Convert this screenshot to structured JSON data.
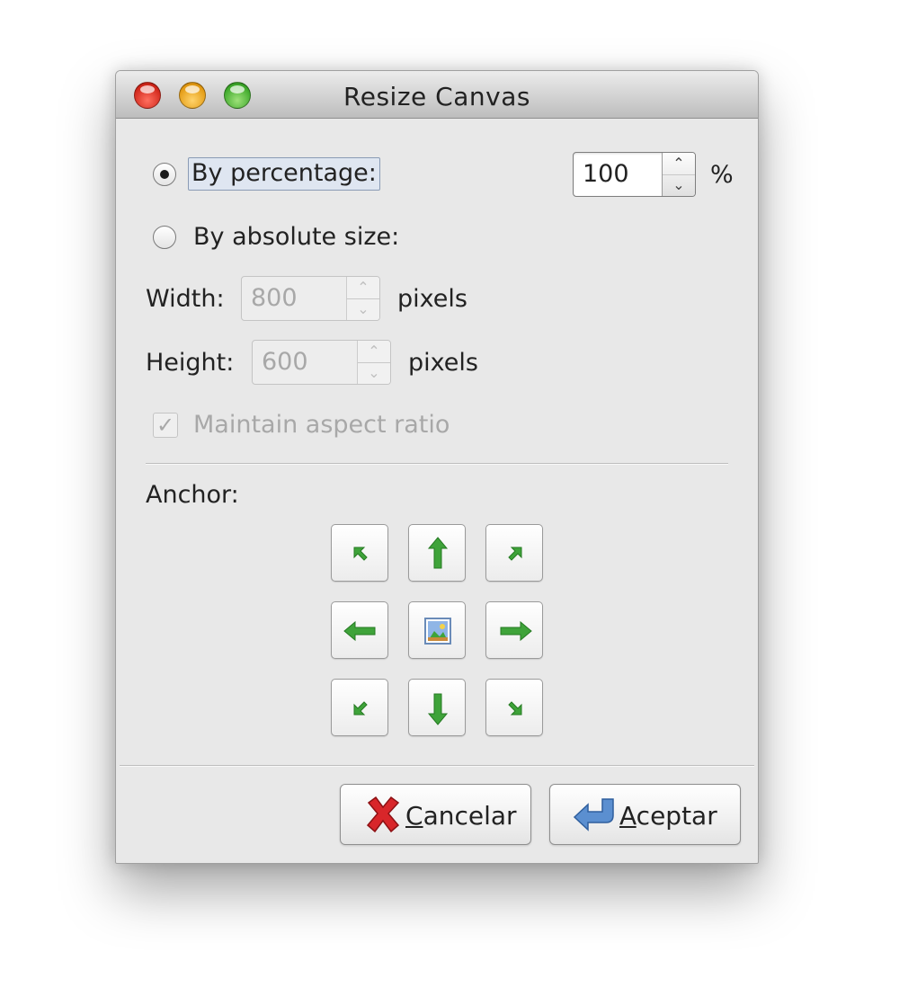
{
  "window": {
    "title": "Resize Canvas"
  },
  "resize_mode": {
    "by_percentage_label": "By percentage:",
    "by_percentage_selected": true,
    "by_absolute_label": "By absolute size:",
    "by_absolute_selected": false
  },
  "percentage": {
    "value": "100",
    "unit": "%"
  },
  "absolute": {
    "width_label": "Width:",
    "width_value": "800",
    "width_unit": "pixels",
    "height_label": "Height:",
    "height_value": "600",
    "height_unit": "pixels",
    "maintain_aspect_label": "Maintain aspect ratio",
    "maintain_aspect_checked": true,
    "enabled": false
  },
  "anchor": {
    "label": "Anchor:",
    "buttons": [
      {
        "name": "anchor-top-left-button",
        "icon": "arrow-up-left-icon"
      },
      {
        "name": "anchor-top-button",
        "icon": "arrow-up-icon"
      },
      {
        "name": "anchor-top-right-button",
        "icon": "arrow-up-right-icon"
      },
      {
        "name": "anchor-left-button",
        "icon": "arrow-left-icon"
      },
      {
        "name": "anchor-center-button",
        "icon": "picture-icon",
        "selected": true
      },
      {
        "name": "anchor-right-button",
        "icon": "arrow-right-icon"
      },
      {
        "name": "anchor-bottom-left-button",
        "icon": "arrow-down-left-icon"
      },
      {
        "name": "anchor-bottom-button",
        "icon": "arrow-down-icon"
      },
      {
        "name": "anchor-bottom-right-button",
        "icon": "arrow-down-right-icon"
      }
    ]
  },
  "buttons": {
    "cancel_mnemonic": "C",
    "cancel_rest": "ancelar",
    "cancel_icon": "red-x-icon",
    "ok_mnemonic": "A",
    "ok_rest": "ceptar",
    "ok_icon": "return-arrow-icon"
  },
  "colors": {
    "arrow_green": "#3fa33a",
    "cancel_red": "#d8262a",
    "ok_blue": "#5b8fd0"
  }
}
